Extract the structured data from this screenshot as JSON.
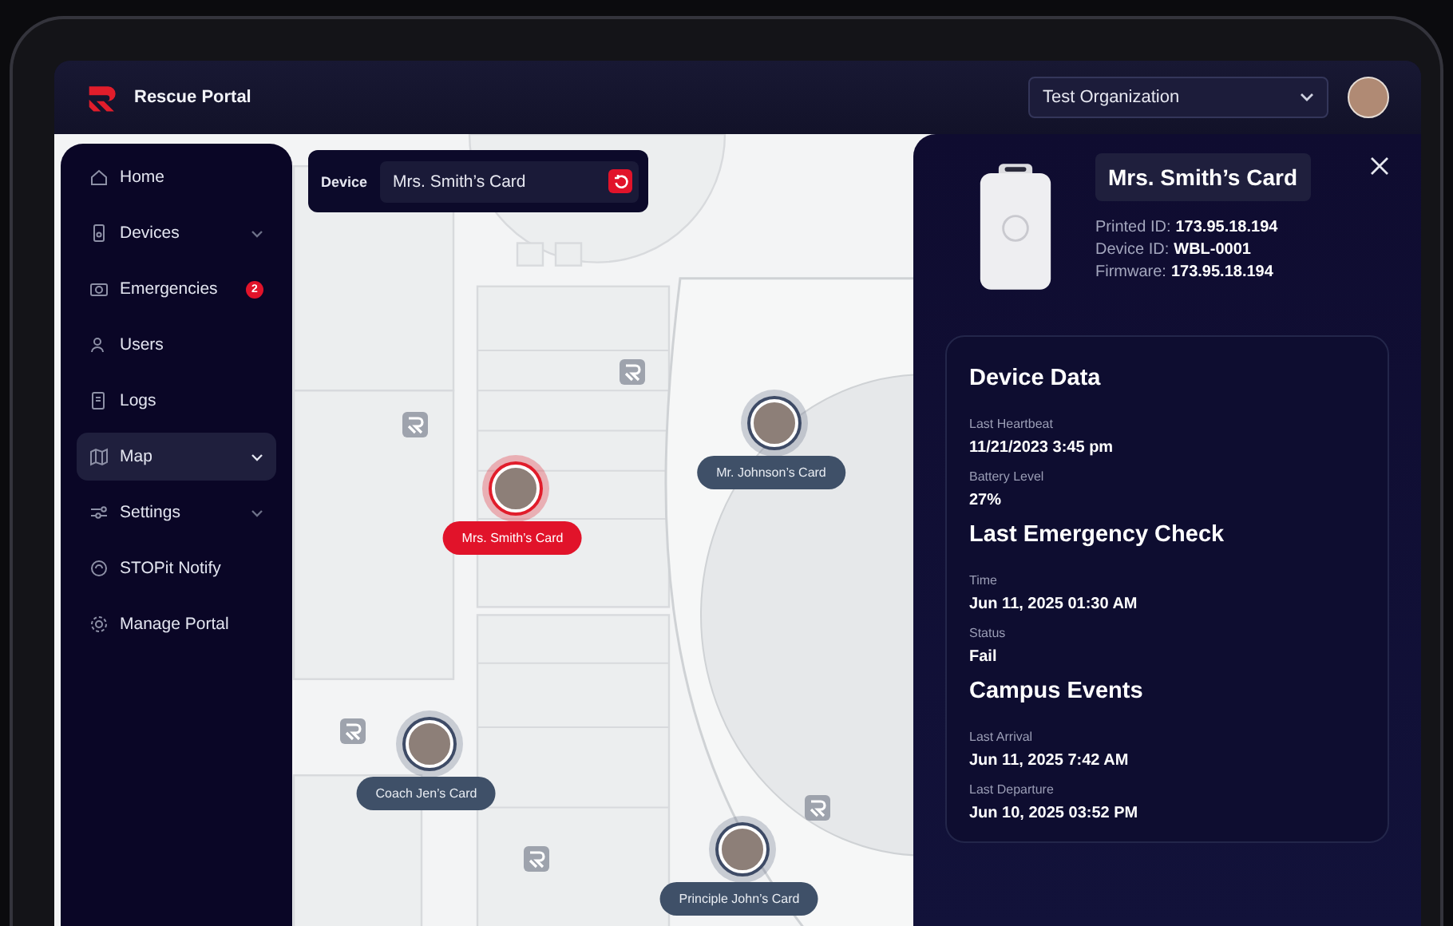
{
  "header": {
    "app_name": "Rescue Portal",
    "organization": "Test Organization"
  },
  "sidebar": {
    "items": [
      {
        "label": "Home",
        "has_submenu": false,
        "selected": false
      },
      {
        "label": "Devices",
        "has_submenu": true,
        "selected": false
      },
      {
        "label": "Emergencies",
        "has_submenu": false,
        "selected": false,
        "badge": "2"
      },
      {
        "label": "Users",
        "has_submenu": false,
        "selected": false
      },
      {
        "label": "Logs",
        "has_submenu": false,
        "selected": false
      },
      {
        "label": "Map",
        "has_submenu": true,
        "selected": true
      },
      {
        "label": "Settings",
        "has_submenu": true,
        "selected": false
      },
      {
        "label": "STOPit Notify",
        "has_submenu": false,
        "selected": false
      },
      {
        "label": "Manage Portal",
        "has_submenu": false,
        "selected": false
      }
    ]
  },
  "device_filter": {
    "label": "Device",
    "value": "Mrs. Smith’s Card"
  },
  "map": {
    "pins": [
      {
        "label": "Mrs. Smith’s Card",
        "selected": true
      },
      {
        "label": "Mr. Johnson’s Card",
        "selected": false
      },
      {
        "label": "Coach Jen’s Card",
        "selected": false
      },
      {
        "label": "Principle John’s Card",
        "selected": false
      }
    ]
  },
  "details": {
    "title": "Mrs. Smith’s Card",
    "ids": [
      {
        "label": "Printed ID:",
        "value": "173.95.18.194"
      },
      {
        "label": "Device ID:",
        "value": "WBL-0001"
      },
      {
        "label": "Firmware:",
        "value": "173.95.18.194"
      }
    ],
    "sections": [
      {
        "title": "Device Data",
        "fields": [
          {
            "label": "Last Heartbeat",
            "value": "11/21/2023 3:45 pm"
          },
          {
            "label": "Battery Level",
            "value": "27%"
          }
        ]
      },
      {
        "title": "Last Emergency Check",
        "fields": [
          {
            "label": "Time",
            "value": "Jun 11, 2025 01:30 AM"
          },
          {
            "label": "Status",
            "value": "Fail"
          }
        ]
      },
      {
        "title": "Campus Events",
        "fields": [
          {
            "label": "Last Arrival",
            "value": "Jun 11, 2025 7:42 AM"
          },
          {
            "label": "Last Departure",
            "value": "Jun 10, 2025 03:52 PM"
          }
        ]
      }
    ]
  }
}
